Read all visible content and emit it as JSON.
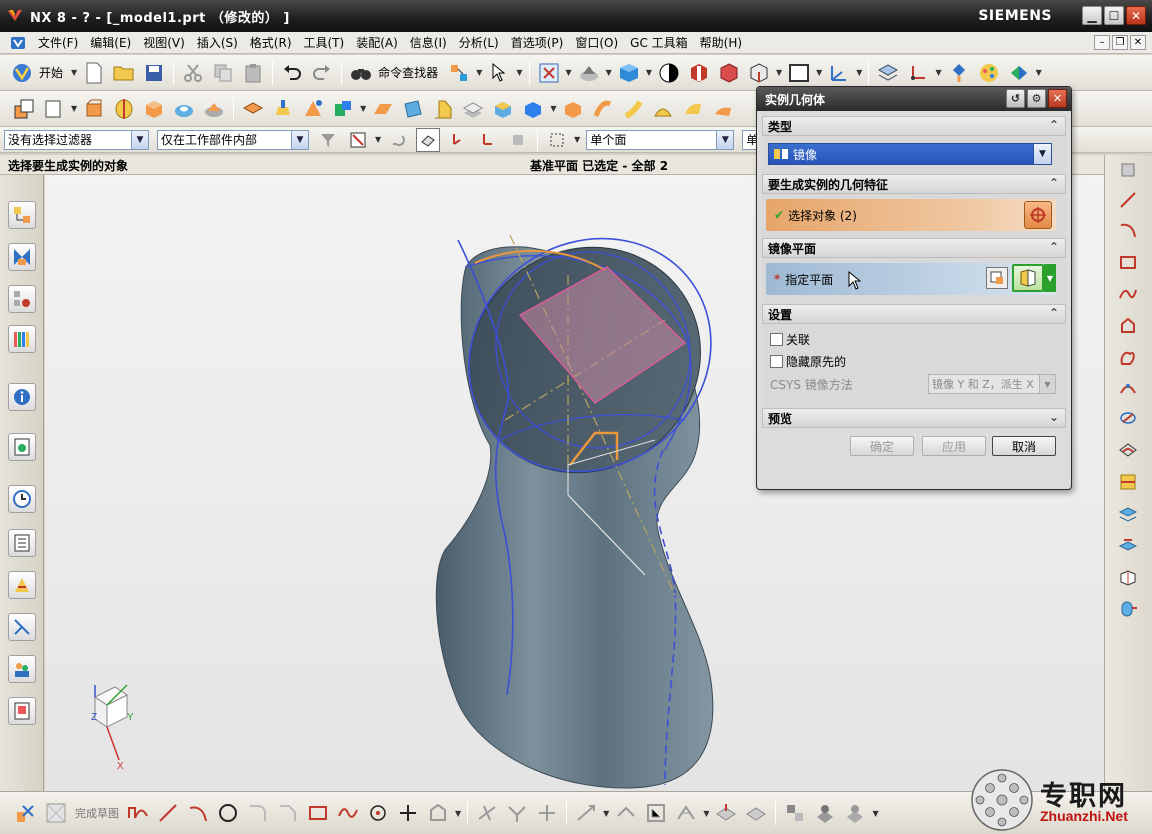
{
  "window": {
    "title": "NX 8 - ? - [_model1.prt （修改的） ]",
    "brand": "SIEMENS",
    "icon": "nx-logo-icon"
  },
  "menubar": {
    "items": [
      "文件(F)",
      "编辑(E)",
      "视图(V)",
      "插入(S)",
      "格式(R)",
      "工具(T)",
      "装配(A)",
      "信息(I)",
      "分析(L)",
      "首选项(P)",
      "窗口(O)",
      "GC 工具箱",
      "帮助(H)"
    ]
  },
  "toolbar": {
    "start_label": "开始",
    "command_finder_label": "命令查找器"
  },
  "selection_bar": {
    "filter": "没有选择过滤器",
    "scope": "仅在工作部件内部",
    "face_rule": "单个面",
    "curve_rule": "单条曲线"
  },
  "status": {
    "prompt": "选择要生成实例的对象",
    "message": "基准平面 已选定 - 全部 2"
  },
  "bottombar": {
    "finish_sketch": "完成草图"
  },
  "dialog": {
    "title": "实例几何体",
    "type_section": "类型",
    "type_value": "镜像",
    "geometry_section": "要生成实例的几何特征",
    "select_objects": "选择对象 (2)",
    "plane_section": "镜像平面",
    "specify_plane": "指定平面",
    "settings_section": "设置",
    "associative": "关联",
    "hide_original": "隐藏原先的",
    "csys_label": "CSYS 镜像方法",
    "csys_value": "镜像 Y 和 Z，派生 X",
    "preview_section": "预览",
    "ok": "确定",
    "apply": "应用",
    "cancel": "取消"
  },
  "watermark": {
    "cn": "专职网",
    "en": "Zhuanzhi.Net"
  },
  "triad": {
    "x": "X",
    "y": "Y",
    "z": "Z"
  },
  "colors": {
    "title_bar": "#1e1e1e",
    "dialog_orange": "#e6a56a",
    "dialog_blue": "#9fb9d4",
    "model_body": "#5b7282",
    "plane": "#c98aa3",
    "curve_blue": "#3d4fd6",
    "watermark_red": "#c01010"
  }
}
